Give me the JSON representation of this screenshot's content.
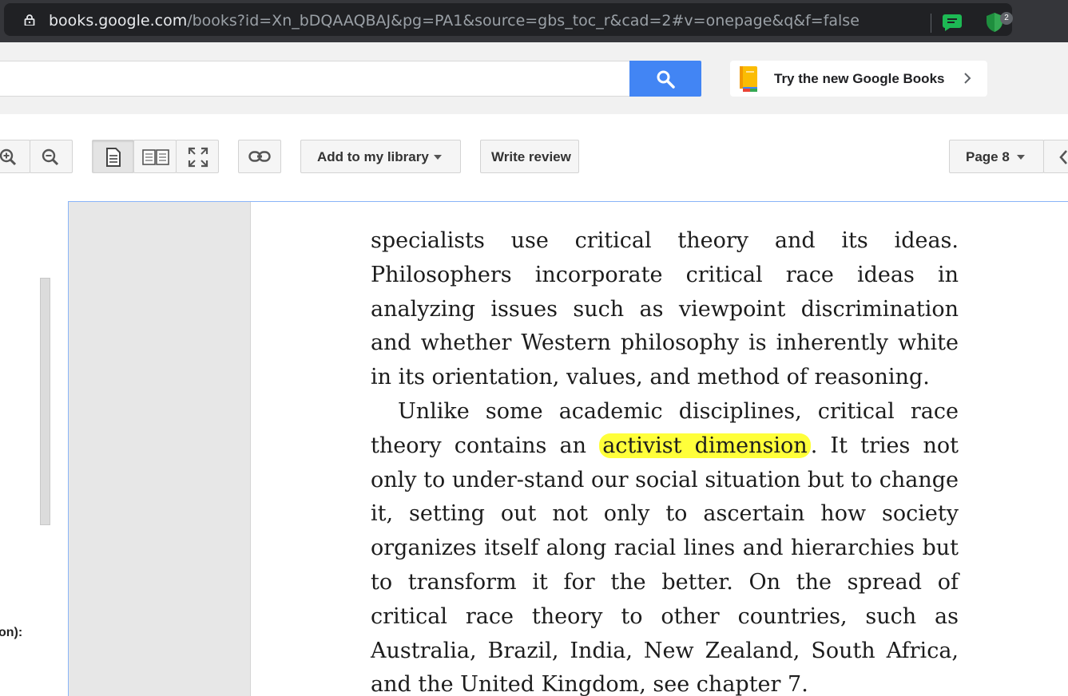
{
  "browser": {
    "url_domain": "books.google.com",
    "url_path": "/books?id=Xn_bDQAAQBAJ&pg=PA1&source=gbs_toc_r&cad=2#v=onepage&q&f=false",
    "extension_badge_count": "2"
  },
  "header": {
    "search_value": "",
    "try_new_label": "Try the new Google Books"
  },
  "toolbar": {
    "add_library_label": "Add to my library",
    "write_review_label": "Write review",
    "page_label": "Page 8"
  },
  "left_panel": {
    "partial_label": "on):"
  },
  "page": {
    "paragraph1": "specialists use critical theory and its ideas. Philosophers incorporate critical race ideas in analyzing issues such as viewpoint discrimination and whether Western philosophy is inherently white in its orientation, values, and method of reasoning.",
    "paragraph2_before": "Unlike some academic disciplines, critical race theory contains an ",
    "paragraph2_highlight": "activist dimension",
    "paragraph2_after": ". It tries not only to under-stand our social situation but to change it, setting out not only to ascertain how society organizes itself along racial lines and hierarchies but to transform it for the better. On the spread of critical race theory to other countries, such as Australia, Brazil, India, New Zealand, South Africa, and the United Kingdom, see chapter 7."
  },
  "colors": {
    "search_button": "#4285f4",
    "highlight": "#ffff3a",
    "viewer_border": "#8ab4f8"
  }
}
